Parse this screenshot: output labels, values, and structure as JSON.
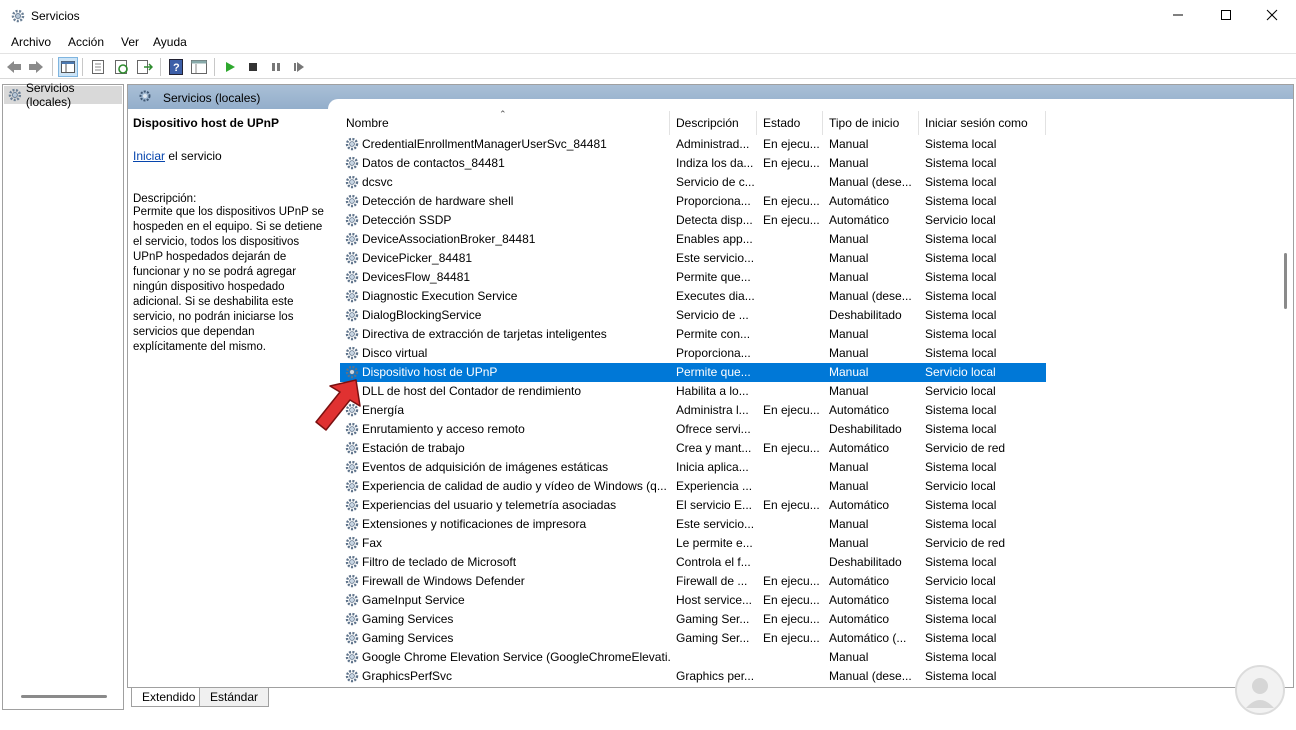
{
  "window": {
    "title": "Servicios"
  },
  "menu": {
    "items": [
      "Archivo",
      "Acción",
      "Ver",
      "Ayuda"
    ]
  },
  "tree": {
    "root_label": "Servicios (locales)"
  },
  "main": {
    "header_title": "Servicios (locales)",
    "details": {
      "service_title": "Dispositivo host de UPnP",
      "action_link": "Iniciar",
      "action_suffix": " el servicio",
      "description_label": "Descripción:",
      "description_text": "Permite que los dispositivos UPnP se hospeden en el equipo. Si se detiene el servicio, todos los dispositivos UPnP hospedados dejarán de funcionar y no se podrá agregar ningún dispositivo hospedado adicional. Si se deshabilita este servicio, no podrán iniciarse los servicios que dependan explícitamente del mismo."
    },
    "columns": [
      "Nombre",
      "Descripción",
      "Estado",
      "Tipo de inicio",
      "Iniciar sesión como"
    ],
    "rows": [
      {
        "name": "CredentialEnrollmentManagerUserSvc_84481",
        "desc": "Administrad...",
        "state": "En ejecu...",
        "type": "Manual",
        "login": "Sistema local"
      },
      {
        "name": "Datos de contactos_84481",
        "desc": "Indiza los da...",
        "state": "En ejecu...",
        "type": "Manual",
        "login": "Sistema local"
      },
      {
        "name": "dcsvc",
        "desc": "Servicio de c...",
        "state": "",
        "type": "Manual (dese...",
        "login": "Sistema local"
      },
      {
        "name": "Detección de hardware shell",
        "desc": "Proporciona...",
        "state": "En ejecu...",
        "type": "Automático",
        "login": "Sistema local"
      },
      {
        "name": "Detección SSDP",
        "desc": "Detecta disp...",
        "state": "En ejecu...",
        "type": "Automático",
        "login": "Servicio local"
      },
      {
        "name": "DeviceAssociationBroker_84481",
        "desc": "Enables app...",
        "state": "",
        "type": "Manual",
        "login": "Sistema local"
      },
      {
        "name": "DevicePicker_84481",
        "desc": "Este servicio...",
        "state": "",
        "type": "Manual",
        "login": "Sistema local"
      },
      {
        "name": "DevicesFlow_84481",
        "desc": "Permite que...",
        "state": "",
        "type": "Manual",
        "login": "Sistema local"
      },
      {
        "name": "Diagnostic Execution Service",
        "desc": "Executes dia...",
        "state": "",
        "type": "Manual (dese...",
        "login": "Sistema local"
      },
      {
        "name": "DialogBlockingService",
        "desc": "Servicio de ...",
        "state": "",
        "type": "Deshabilitado",
        "login": "Sistema local"
      },
      {
        "name": "Directiva de extracción de tarjetas inteligentes",
        "desc": "Permite con...",
        "state": "",
        "type": "Manual",
        "login": "Sistema local"
      },
      {
        "name": "Disco virtual",
        "desc": "Proporciona...",
        "state": "",
        "type": "Manual",
        "login": "Sistema local"
      },
      {
        "name": "Dispositivo host de UPnP",
        "desc": "Permite que...",
        "state": "",
        "type": "Manual",
        "login": "Servicio local",
        "selected": true
      },
      {
        "name": "DLL de host del Contador de rendimiento",
        "desc": "Habilita a lo...",
        "state": "",
        "type": "Manual",
        "login": "Servicio local"
      },
      {
        "name": "Energía",
        "desc": "Administra l...",
        "state": "En ejecu...",
        "type": "Automático",
        "login": "Sistema local"
      },
      {
        "name": "Enrutamiento y acceso remoto",
        "desc": "Ofrece servi...",
        "state": "",
        "type": "Deshabilitado",
        "login": "Sistema local"
      },
      {
        "name": "Estación de trabajo",
        "desc": "Crea y mant...",
        "state": "En ejecu...",
        "type": "Automático",
        "login": "Servicio de red"
      },
      {
        "name": "Eventos de adquisición de imágenes estáticas",
        "desc": "Inicia aplica...",
        "state": "",
        "type": "Manual",
        "login": "Sistema local"
      },
      {
        "name": "Experiencia de calidad de audio y vídeo de Windows (q...",
        "desc": "Experiencia ...",
        "state": "",
        "type": "Manual",
        "login": "Servicio local"
      },
      {
        "name": "Experiencias del usuario y telemetría asociadas",
        "desc": "El servicio E...",
        "state": "En ejecu...",
        "type": "Automático",
        "login": "Sistema local"
      },
      {
        "name": "Extensiones y notificaciones de impresora",
        "desc": "Este servicio...",
        "state": "",
        "type": "Manual",
        "login": "Sistema local"
      },
      {
        "name": "Fax",
        "desc": "Le permite e...",
        "state": "",
        "type": "Manual",
        "login": "Servicio de red"
      },
      {
        "name": "Filtro de teclado de Microsoft",
        "desc": "Controla el f...",
        "state": "",
        "type": "Deshabilitado",
        "login": "Sistema local"
      },
      {
        "name": "Firewall de Windows Defender",
        "desc": "Firewall de ...",
        "state": "En ejecu...",
        "type": "Automático",
        "login": "Servicio local"
      },
      {
        "name": "GameInput Service",
        "desc": "Host service...",
        "state": "En ejecu...",
        "type": "Automático",
        "login": "Sistema local"
      },
      {
        "name": "Gaming Services",
        "desc": "Gaming Ser...",
        "state": "En ejecu...",
        "type": "Automático",
        "login": "Sistema local"
      },
      {
        "name": "Gaming Services",
        "desc": "Gaming Ser...",
        "state": "En ejecu...",
        "type": "Automático (...",
        "login": "Sistema local"
      },
      {
        "name": "Google Chrome Elevation Service (GoogleChromeElevati...",
        "desc": "",
        "state": "",
        "type": "Manual",
        "login": "Sistema local"
      },
      {
        "name": "GraphicsPerfSvc",
        "desc": "Graphics per...",
        "state": "",
        "type": "Manual (dese...",
        "login": "Sistema local"
      }
    ]
  },
  "tabs": [
    "Extendido",
    "Estándar"
  ],
  "colors": {
    "selection": "#0078d7",
    "header_band": "#a9bfd6",
    "arrow": "#e03131",
    "link": "#0645ad"
  }
}
